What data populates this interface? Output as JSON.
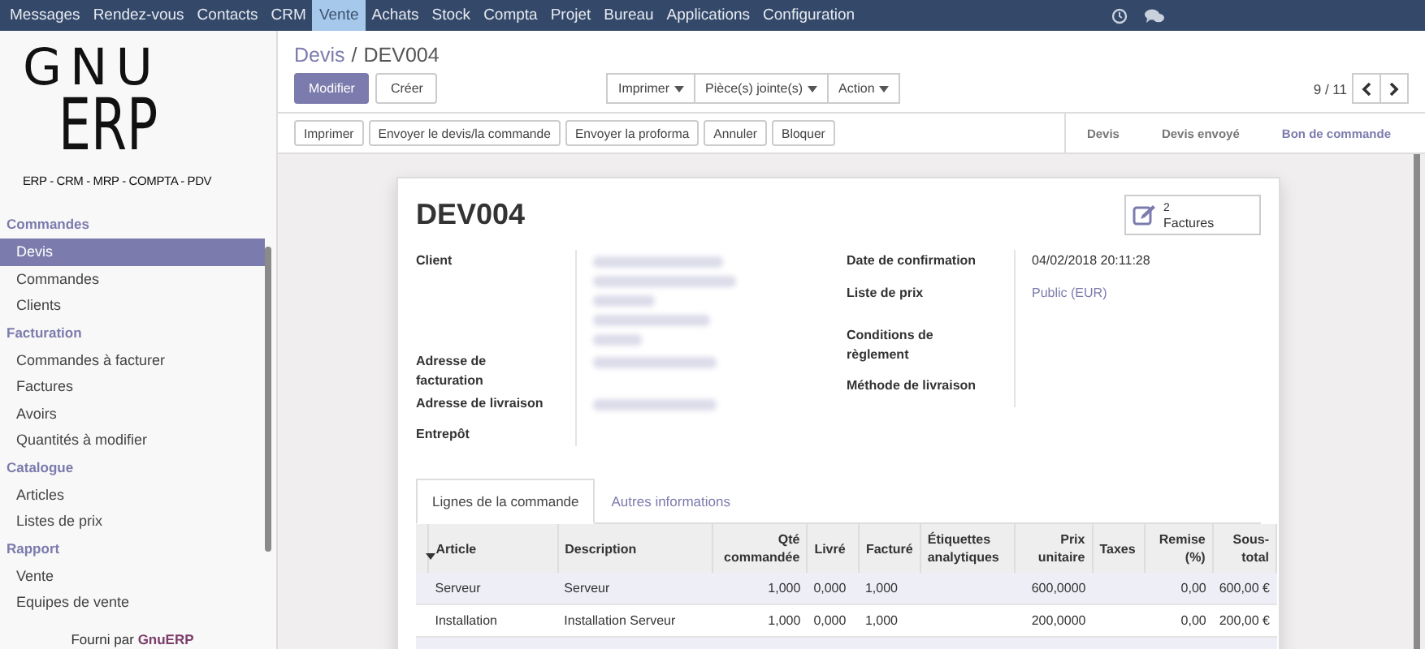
{
  "top_menu": [
    {
      "label": "Messages",
      "selected": false
    },
    {
      "label": "Rendez-vous",
      "selected": false
    },
    {
      "label": "Contacts",
      "selected": false
    },
    {
      "label": "CRM",
      "selected": false
    },
    {
      "label": "Vente",
      "selected": true
    },
    {
      "label": "Achats",
      "selected": false
    },
    {
      "label": "Stock",
      "selected": false
    },
    {
      "label": "Compta",
      "selected": false
    },
    {
      "label": "Projet",
      "selected": false
    },
    {
      "label": "Bureau",
      "selected": false
    },
    {
      "label": "Applications",
      "selected": false
    },
    {
      "label": "Configuration",
      "selected": false
    }
  ],
  "logo": {
    "line1": "GNU",
    "line2": "ERP",
    "tagline": "ERP - CRM - MRP - COMPTA - PDV"
  },
  "sidebar": {
    "sections": [
      {
        "title": "Commandes",
        "items": [
          {
            "label": "Devis",
            "selected": true
          },
          {
            "label": "Commandes",
            "selected": false
          },
          {
            "label": "Clients",
            "selected": false
          }
        ]
      },
      {
        "title": "Facturation",
        "items": [
          {
            "label": "Commandes à facturer",
            "selected": false
          },
          {
            "label": "Factures",
            "selected": false
          },
          {
            "label": "Avoirs",
            "selected": false
          },
          {
            "label": "Quantités à modifier",
            "selected": false
          }
        ]
      },
      {
        "title": "Catalogue",
        "items": [
          {
            "label": "Articles",
            "selected": false
          },
          {
            "label": "Listes de prix",
            "selected": false
          }
        ]
      },
      {
        "title": "Rapport",
        "items": [
          {
            "label": "Vente",
            "selected": false
          },
          {
            "label": "Equipes de vente",
            "selected": false
          }
        ]
      }
    ],
    "footer_prefix": "Fourni par",
    "footer_link": "GnuERP"
  },
  "breadcrumb": {
    "parent": "Devis",
    "separator": "/",
    "current": "DEV004"
  },
  "buttons": [
    {
      "label": "Modifier",
      "kind": "primary"
    },
    {
      "label": "Créer",
      "kind": "default"
    }
  ],
  "dropdowns": [
    "Imprimer",
    "Pièce(s) jointe(s)",
    "Action"
  ],
  "pager": "9 / 11",
  "actions": [
    "Imprimer",
    "Envoyer le devis/la commande",
    "Envoyer la proforma",
    "Annuler",
    "Bloquer"
  ],
  "status_steps": [
    {
      "label": "Devis",
      "selected": false
    },
    {
      "label": "Devis envoyé",
      "selected": false
    },
    {
      "label": "Bon de commande",
      "selected": true
    }
  ],
  "record": {
    "title": "DEV004",
    "smart_button": {
      "count": "2",
      "label": "Factures"
    },
    "left_fields": [
      {
        "label": "Client"
      },
      {
        "label": "Adresse de facturation"
      },
      {
        "label": "Adresse de livraison"
      },
      {
        "label": "Entrepôt"
      }
    ],
    "right_fields": [
      {
        "label": "Date de confirmation",
        "value": "04/02/2018 20:11:28",
        "kind": "text"
      },
      {
        "label": "Liste de prix",
        "value": "Public (EUR)",
        "kind": "link"
      },
      {
        "label": "Conditions de règlement"
      },
      {
        "label": "Méthode de livraison"
      }
    ]
  },
  "tabs": [
    {
      "label": "Lignes de la commande",
      "selected": true
    },
    {
      "label": "Autres informations",
      "selected": false
    }
  ],
  "table": {
    "columns": [
      "Article",
      "Description",
      "Qté commandée",
      "Livré",
      "Facturé",
      "Étiquettes analytiques",
      "Prix unitaire",
      "Taxes",
      "Remise (%)",
      "Sous-total"
    ],
    "rows": [
      {
        "selected": true,
        "cells": [
          "Serveur",
          "Serveur",
          "1,000",
          "0,000",
          "1,000",
          "",
          "600,0000",
          "",
          "0,00",
          "600,00 €"
        ]
      },
      {
        "selected": false,
        "cells": [
          "Installation",
          "Installation Serveur",
          "1,000",
          "0,000",
          "1,000",
          "",
          "200,0000",
          "",
          "0,00",
          "200,00 €"
        ]
      }
    ]
  }
}
